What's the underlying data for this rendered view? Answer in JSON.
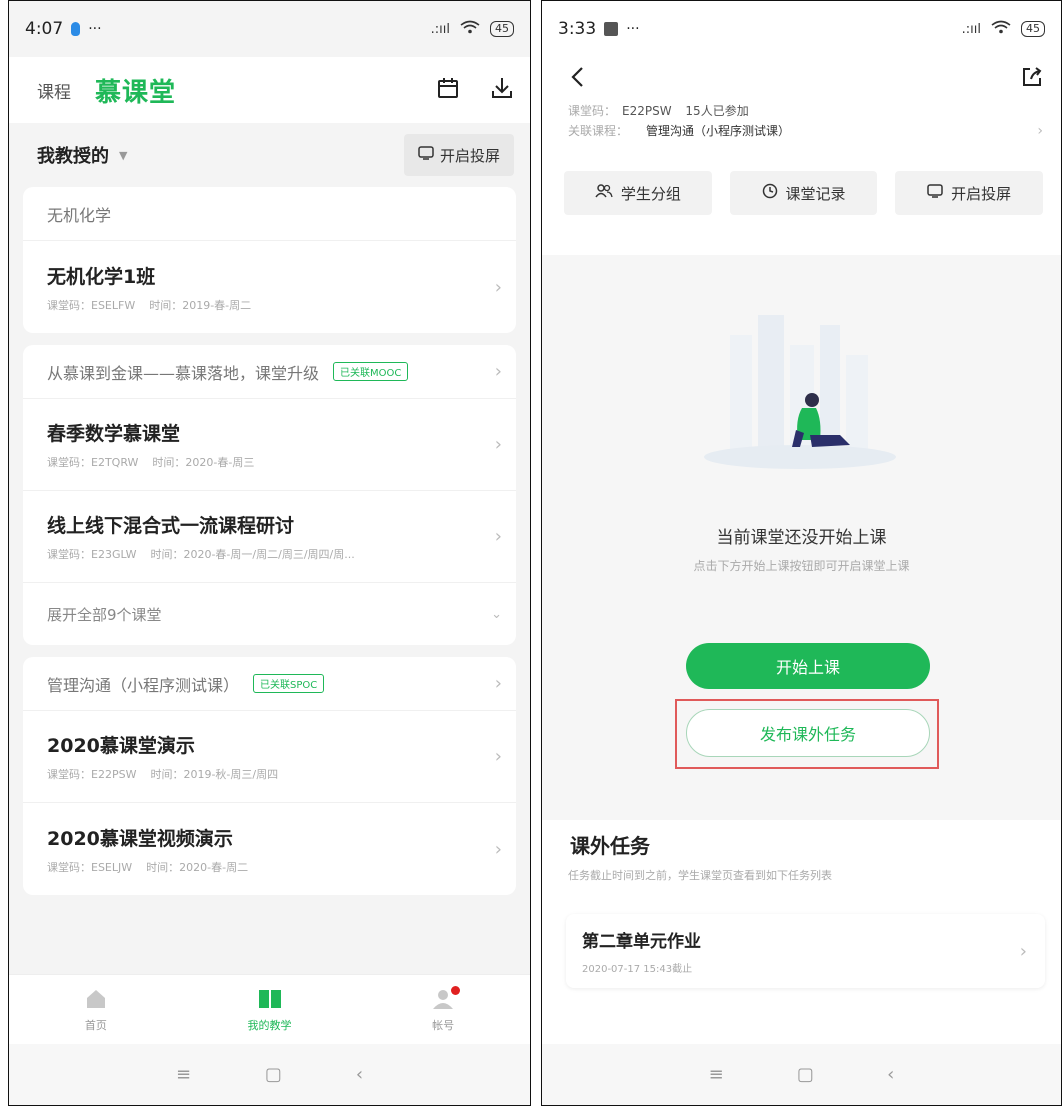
{
  "left": {
    "status": {
      "time": "4:07",
      "dots": "···",
      "signal": ".:ııl",
      "battery": "45"
    },
    "header": {
      "tab_course": "课程",
      "tab_mooc": "慕课堂"
    },
    "filter": {
      "title": "我教授的",
      "cast_label": "开启投屏"
    },
    "groups": [
      {
        "title": "无机化学",
        "tag": "",
        "classes": [
          {
            "name": "无机化学1班",
            "code": "课堂码：ESELFW",
            "time": "时间：2019-春-周二"
          }
        ]
      },
      {
        "title": "从慕课到金课——慕课落地，课堂升级",
        "tag": "已关联MOOC",
        "classes": [
          {
            "name": "春季数学慕课堂",
            "code": "课堂码：E2TQRW",
            "time": "时间：2020-春-周三"
          },
          {
            "name": "线上线下混合式一流课程研讨",
            "code": "课堂码：E23GLW",
            "time": "时间：2020-春-周一/周二/周三/周四/周..."
          }
        ],
        "expand": "展开全部9个课堂"
      },
      {
        "title": "管理沟通（小程序测试课）",
        "tag": "已关联SPOC",
        "classes": [
          {
            "name": "2020慕课堂演示",
            "code": "课堂码：E22PSW",
            "time": "时间：2019-秋-周三/周四"
          },
          {
            "name": "2020慕课堂视频演示",
            "code": "课堂码：ESELJW",
            "time": "时间：2020-春-周二"
          }
        ]
      }
    ],
    "tabbar": {
      "home": "首页",
      "teaching": "我的教学",
      "account": "帐号"
    }
  },
  "right": {
    "status": {
      "time": "3:33",
      "dots": "···",
      "signal": ".:ııl",
      "battery": "45"
    },
    "info": {
      "code_label": "课堂码：",
      "code": "E22PSW",
      "joined": "15人已参加",
      "course_label": "关联课程：",
      "course": "管理沟通（小程序测试课）"
    },
    "buttons": {
      "group": "学生分组",
      "record": "课堂记录",
      "cast": "开启投屏"
    },
    "empty": {
      "title": "当前课堂还没开始上课",
      "subtitle": "点击下方开始上课按钮即可开启课堂上课"
    },
    "start_label": "开始上课",
    "publish_label": "发布课外任务",
    "tasks": {
      "title": "课外任务",
      "subtitle": "任务截止时间到之前，学生课堂页查看到如下任务列表",
      "items": [
        {
          "name": "第二章单元作业",
          "deadline": "2020-07-17 15:43截止"
        }
      ]
    }
  },
  "colors": {
    "accent": "#1fb858",
    "highlight": "#e05a5a"
  }
}
